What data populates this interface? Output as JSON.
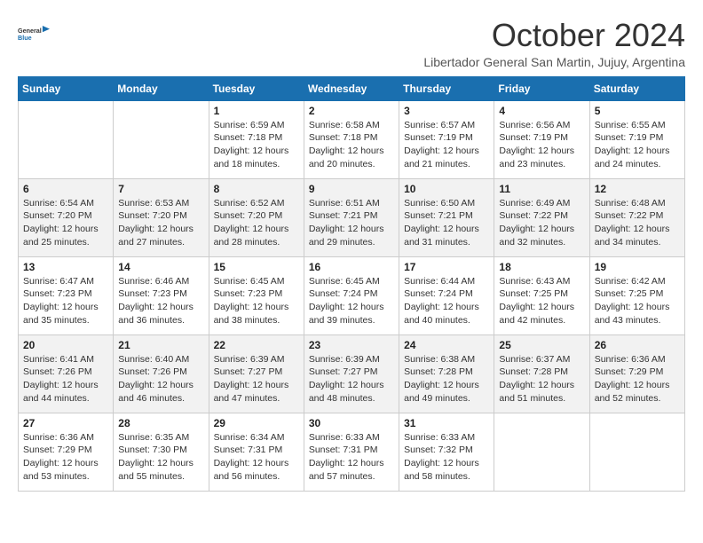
{
  "header": {
    "logo": {
      "general": "General",
      "blue": "Blue"
    },
    "title": "October 2024",
    "location": "Libertador General San Martin, Jujuy, Argentina"
  },
  "days_of_week": [
    "Sunday",
    "Monday",
    "Tuesday",
    "Wednesday",
    "Thursday",
    "Friday",
    "Saturday"
  ],
  "weeks": [
    [
      null,
      null,
      {
        "day": 1,
        "sunrise": "6:59 AM",
        "sunset": "7:18 PM",
        "daylight": "12 hours and 18 minutes."
      },
      {
        "day": 2,
        "sunrise": "6:58 AM",
        "sunset": "7:18 PM",
        "daylight": "12 hours and 20 minutes."
      },
      {
        "day": 3,
        "sunrise": "6:57 AM",
        "sunset": "7:19 PM",
        "daylight": "12 hours and 21 minutes."
      },
      {
        "day": 4,
        "sunrise": "6:56 AM",
        "sunset": "7:19 PM",
        "daylight": "12 hours and 23 minutes."
      },
      {
        "day": 5,
        "sunrise": "6:55 AM",
        "sunset": "7:19 PM",
        "daylight": "12 hours and 24 minutes."
      }
    ],
    [
      {
        "day": 6,
        "sunrise": "6:54 AM",
        "sunset": "7:20 PM",
        "daylight": "12 hours and 25 minutes."
      },
      {
        "day": 7,
        "sunrise": "6:53 AM",
        "sunset": "7:20 PM",
        "daylight": "12 hours and 27 minutes."
      },
      {
        "day": 8,
        "sunrise": "6:52 AM",
        "sunset": "7:20 PM",
        "daylight": "12 hours and 28 minutes."
      },
      {
        "day": 9,
        "sunrise": "6:51 AM",
        "sunset": "7:21 PM",
        "daylight": "12 hours and 29 minutes."
      },
      {
        "day": 10,
        "sunrise": "6:50 AM",
        "sunset": "7:21 PM",
        "daylight": "12 hours and 31 minutes."
      },
      {
        "day": 11,
        "sunrise": "6:49 AM",
        "sunset": "7:22 PM",
        "daylight": "12 hours and 32 minutes."
      },
      {
        "day": 12,
        "sunrise": "6:48 AM",
        "sunset": "7:22 PM",
        "daylight": "12 hours and 34 minutes."
      }
    ],
    [
      {
        "day": 13,
        "sunrise": "6:47 AM",
        "sunset": "7:23 PM",
        "daylight": "12 hours and 35 minutes."
      },
      {
        "day": 14,
        "sunrise": "6:46 AM",
        "sunset": "7:23 PM",
        "daylight": "12 hours and 36 minutes."
      },
      {
        "day": 15,
        "sunrise": "6:45 AM",
        "sunset": "7:23 PM",
        "daylight": "12 hours and 38 minutes."
      },
      {
        "day": 16,
        "sunrise": "6:45 AM",
        "sunset": "7:24 PM",
        "daylight": "12 hours and 39 minutes."
      },
      {
        "day": 17,
        "sunrise": "6:44 AM",
        "sunset": "7:24 PM",
        "daylight": "12 hours and 40 minutes."
      },
      {
        "day": 18,
        "sunrise": "6:43 AM",
        "sunset": "7:25 PM",
        "daylight": "12 hours and 42 minutes."
      },
      {
        "day": 19,
        "sunrise": "6:42 AM",
        "sunset": "7:25 PM",
        "daylight": "12 hours and 43 minutes."
      }
    ],
    [
      {
        "day": 20,
        "sunrise": "6:41 AM",
        "sunset": "7:26 PM",
        "daylight": "12 hours and 44 minutes."
      },
      {
        "day": 21,
        "sunrise": "6:40 AM",
        "sunset": "7:26 PM",
        "daylight": "12 hours and 46 minutes."
      },
      {
        "day": 22,
        "sunrise": "6:39 AM",
        "sunset": "7:27 PM",
        "daylight": "12 hours and 47 minutes."
      },
      {
        "day": 23,
        "sunrise": "6:39 AM",
        "sunset": "7:27 PM",
        "daylight": "12 hours and 48 minutes."
      },
      {
        "day": 24,
        "sunrise": "6:38 AM",
        "sunset": "7:28 PM",
        "daylight": "12 hours and 49 minutes."
      },
      {
        "day": 25,
        "sunrise": "6:37 AM",
        "sunset": "7:28 PM",
        "daylight": "12 hours and 51 minutes."
      },
      {
        "day": 26,
        "sunrise": "6:36 AM",
        "sunset": "7:29 PM",
        "daylight": "12 hours and 52 minutes."
      }
    ],
    [
      {
        "day": 27,
        "sunrise": "6:36 AM",
        "sunset": "7:29 PM",
        "daylight": "12 hours and 53 minutes."
      },
      {
        "day": 28,
        "sunrise": "6:35 AM",
        "sunset": "7:30 PM",
        "daylight": "12 hours and 55 minutes."
      },
      {
        "day": 29,
        "sunrise": "6:34 AM",
        "sunset": "7:31 PM",
        "daylight": "12 hours and 56 minutes."
      },
      {
        "day": 30,
        "sunrise": "6:33 AM",
        "sunset": "7:31 PM",
        "daylight": "12 hours and 57 minutes."
      },
      {
        "day": 31,
        "sunrise": "6:33 AM",
        "sunset": "7:32 PM",
        "daylight": "12 hours and 58 minutes."
      },
      null,
      null
    ]
  ]
}
